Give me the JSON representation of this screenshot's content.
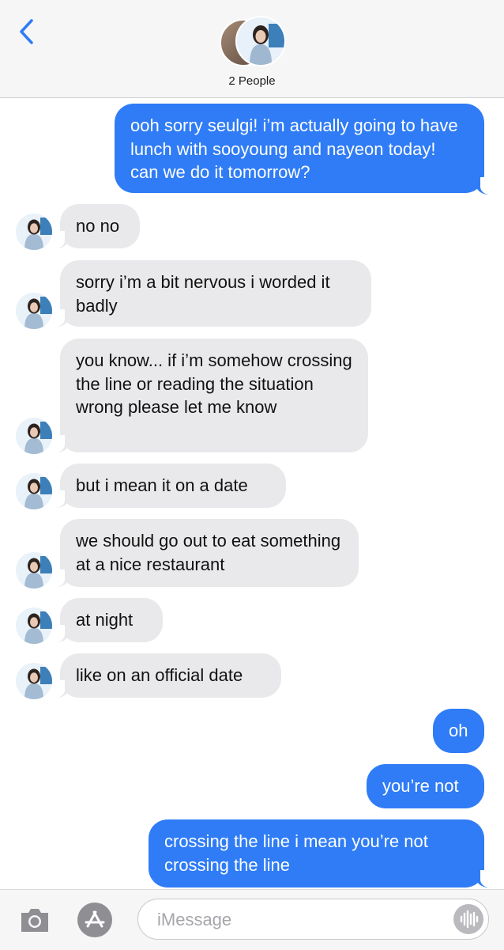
{
  "header": {
    "title": "2 People"
  },
  "messages": [
    {
      "side": "out",
      "text": "ooh sorry seulgi! i’m actually going to have lunch with sooyoung and nayeon today! can we do it tomorrow?"
    },
    {
      "side": "in",
      "text": "no no"
    },
    {
      "side": "in",
      "text": "sorry i’m a bit nervous i worded it badly"
    },
    {
      "side": "in",
      "text": "you know... if i’m somehow crossing the line or reading the situation wrong please let me know"
    },
    {
      "side": "in",
      "text": "but i mean it on a date"
    },
    {
      "side": "in",
      "text": "we should go out to eat something at a nice restaurant"
    },
    {
      "side": "in",
      "text": "at night"
    },
    {
      "side": "in",
      "text": "like on an official date"
    },
    {
      "side": "out",
      "text": "oh"
    },
    {
      "side": "out",
      "text": "you’re not"
    },
    {
      "side": "out",
      "text": "crossing the line i mean you’re not crossing the line"
    }
  ],
  "input": {
    "placeholder": "iMessage"
  },
  "icons": {
    "back": "chevron-left-icon",
    "camera": "camera-icon",
    "apps": "app-store-icon",
    "audio": "audio-waveform-icon"
  },
  "colors": {
    "outgoing": "#2f7cf6",
    "incoming": "#e9e9eb",
    "accent": "#2f7cf6"
  }
}
